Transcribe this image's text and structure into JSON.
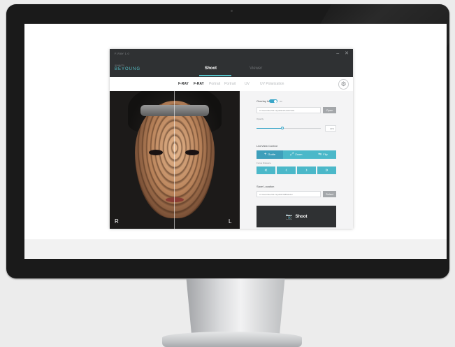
{
  "app": {
    "title": "F-RAY 1.0",
    "window_controls": {
      "minimize": "–",
      "close": "✕"
    },
    "brand_small": "created by",
    "brand_logo": "BEYOUNG"
  },
  "main_tabs": [
    {
      "label": "Shoot",
      "active": true
    },
    {
      "label": "Viewer",
      "active": false
    }
  ],
  "sub_tabs": [
    {
      "label": "F-RAY",
      "active": true
    },
    {
      "label": "F-RAY",
      "active": true
    },
    {
      "label": "Portrait",
      "active": false
    },
    {
      "label": "Portrait",
      "active": false
    },
    {
      "label": "UV",
      "active": false
    },
    {
      "label": "UV  Polarization",
      "active": false
    }
  ],
  "settings_icon": "gear-icon",
  "photo": {
    "left_marker": "R",
    "right_marker": "L"
  },
  "overlay": {
    "label": "Overlay Image",
    "toggle_state": "On",
    "path": "C:\\Users\\dev\\01-ray\\20\\012\\-RAY\\201",
    "open_button": "Open",
    "opacity_label": "Opacity",
    "opacity_value": "40%",
    "opacity_level": 0.4
  },
  "liveview": {
    "label": "LiveView Control",
    "buttons": [
      {
        "label": "Guide",
        "icon": "plus-icon",
        "active": true
      },
      {
        "label": "Zoom",
        "icon": "zoom-icon",
        "active": false
      },
      {
        "label": "Flip",
        "icon": "flip-icon",
        "active": false
      }
    ],
    "focus_label": "Focus Distance",
    "focus_buttons": [
      "«",
      "‹",
      "›",
      "»"
    ]
  },
  "save": {
    "label": "Save Location",
    "path": "C:\\Users\\dev\\01-ray\\20\\0708\\Model",
    "select_button": "Select"
  },
  "shoot_button": {
    "label": "Shoot",
    "icon": "camera-icon"
  },
  "colors": {
    "accent": "#4bb8c9",
    "titlebar": "#2f3133",
    "panel": "#f4f4f5"
  }
}
